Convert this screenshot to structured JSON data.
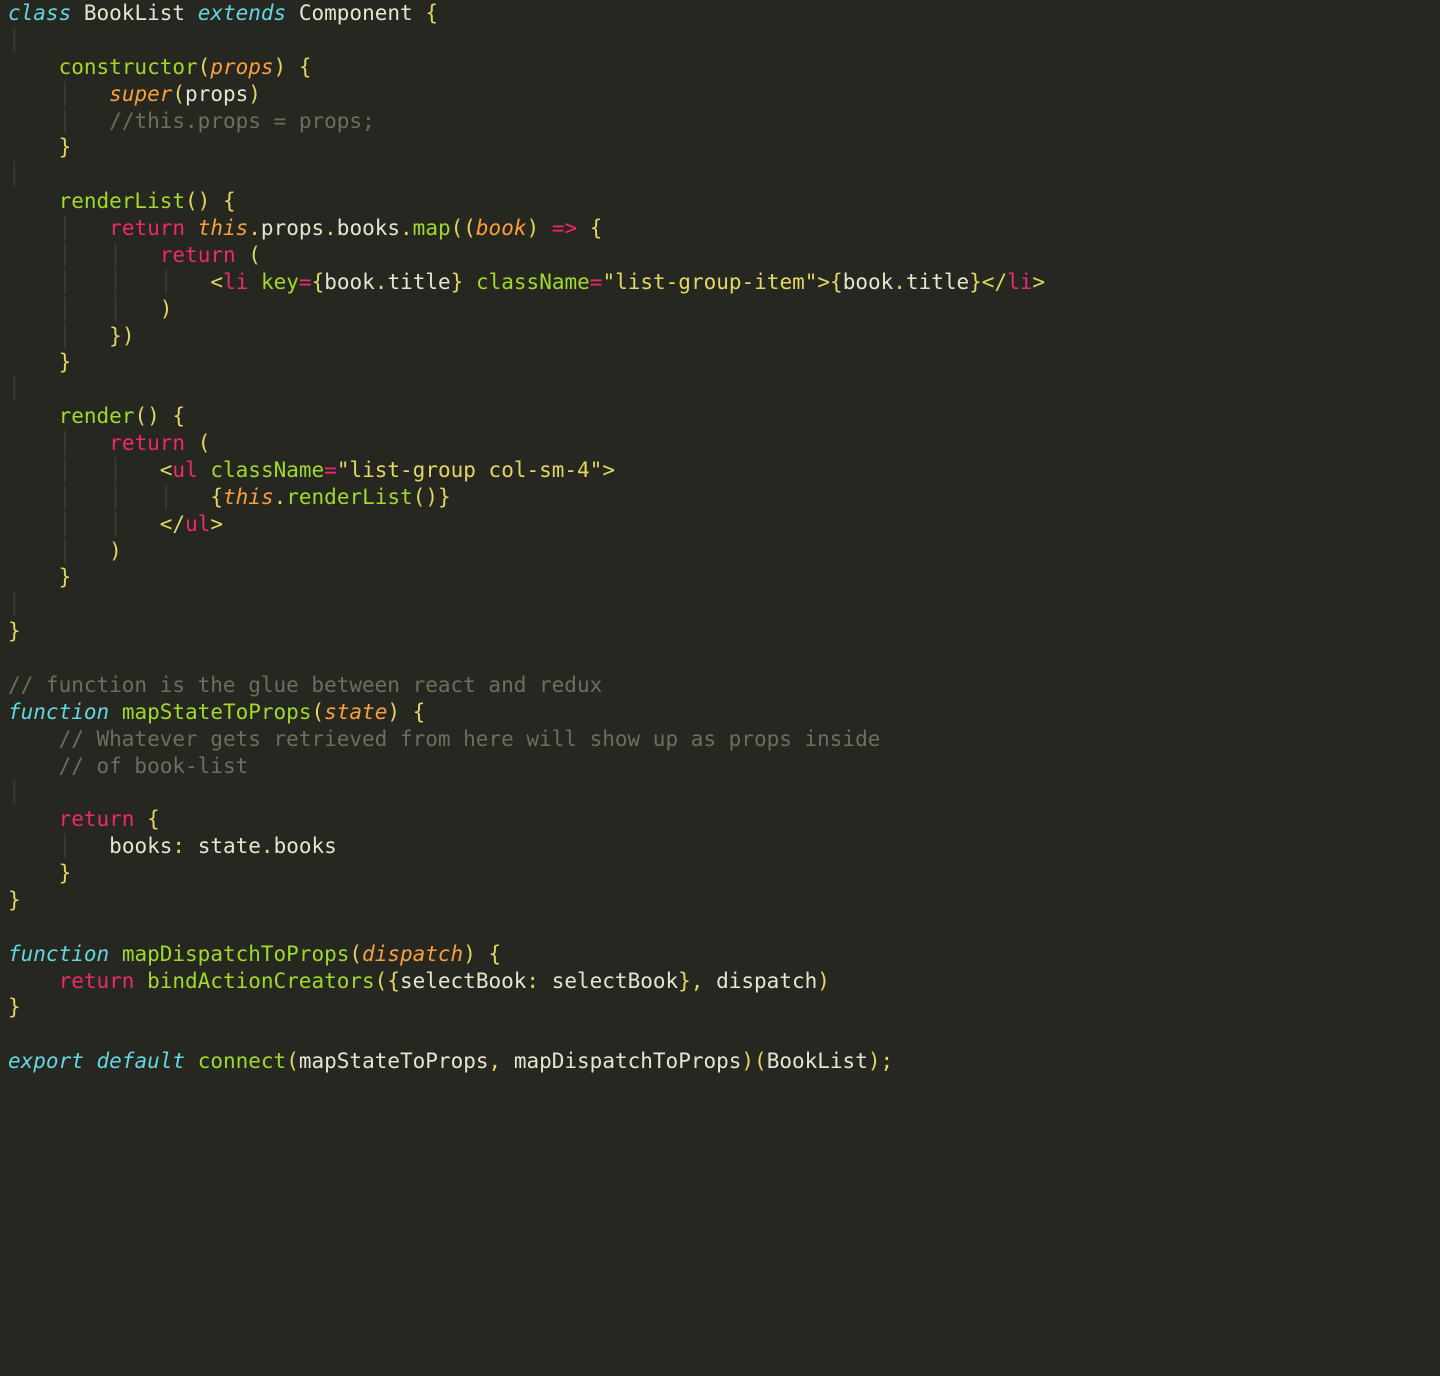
{
  "code": {
    "lines": {
      "l1": {
        "class_kw": "class",
        "class_name": "BookList",
        "extends_kw": "extends",
        "super_name": "Component",
        "brace": "{"
      },
      "l3": {
        "ctor": "constructor",
        "param": "props",
        "brace": "{"
      },
      "l4": {
        "super_kw": "super",
        "arg": "props"
      },
      "l5": {
        "comment": "//this.props = props;"
      },
      "l6": {
        "brace": "}"
      },
      "l8": {
        "fn": "renderList",
        "parens": "()",
        "brace": "{"
      },
      "l9": {
        "return_kw": "return",
        "this_kw": "this",
        "props": "props",
        "books": "books",
        "map": "map",
        "param": "book",
        "arrow": "=>",
        "brace": "{"
      },
      "l10": {
        "return_kw": "return",
        "open": "("
      },
      "l11": {
        "tag_li": "li",
        "attr_key": "key",
        "expr1_o": "book",
        "expr1_p": "title",
        "attr_cls": "className",
        "str_cls": "\"list-group-item\"",
        "expr2_o": "book",
        "expr2_p": "title",
        "close_li": "li"
      },
      "l12": {
        "close": ")"
      },
      "l13": {
        "close": "})"
      },
      "l14": {
        "brace": "}"
      },
      "l16": {
        "fn": "render",
        "parens": "()",
        "brace": "{"
      },
      "l17": {
        "return_kw": "return",
        "open": "("
      },
      "l18": {
        "tag_ul": "ul",
        "attr_cls": "className",
        "str_cls": "\"list-group col-sm-4\""
      },
      "l19": {
        "this_kw": "this",
        "renderList": "renderList"
      },
      "l20": {
        "close_ul": "ul"
      },
      "l21": {
        "close": ")"
      },
      "l22": {
        "brace": "}"
      },
      "l24": {
        "brace": "}"
      },
      "l26": {
        "comment": "// function is the glue between react and redux"
      },
      "l27": {
        "fn_kw": "function",
        "fn": "mapStateToProps",
        "param": "state",
        "brace": "{"
      },
      "l28": {
        "comment": "// Whatever gets retrieved from here will show up as props inside"
      },
      "l29": {
        "comment": "// of book-list"
      },
      "l31": {
        "return_kw": "return",
        "brace": "{"
      },
      "l32": {
        "key": "books",
        "state": "state",
        "prop": "books"
      },
      "l33": {
        "brace": "}"
      },
      "l34": {
        "brace": "}"
      },
      "l36": {
        "fn_kw": "function",
        "fn": "mapDispatchToProps",
        "param": "dispatch",
        "brace": "{"
      },
      "l37": {
        "return_kw": "return",
        "fn": "bindActionCreators",
        "key": "selectBook",
        "val": "selectBook",
        "arg2": "dispatch"
      },
      "l38": {
        "brace": "}"
      },
      "l40": {
        "export_kw": "export",
        "default_kw": "default",
        "connect": "connect",
        "arg1": "mapStateToProps",
        "arg2": "mapDispatchToProps",
        "arg3": "BookList"
      }
    }
  }
}
